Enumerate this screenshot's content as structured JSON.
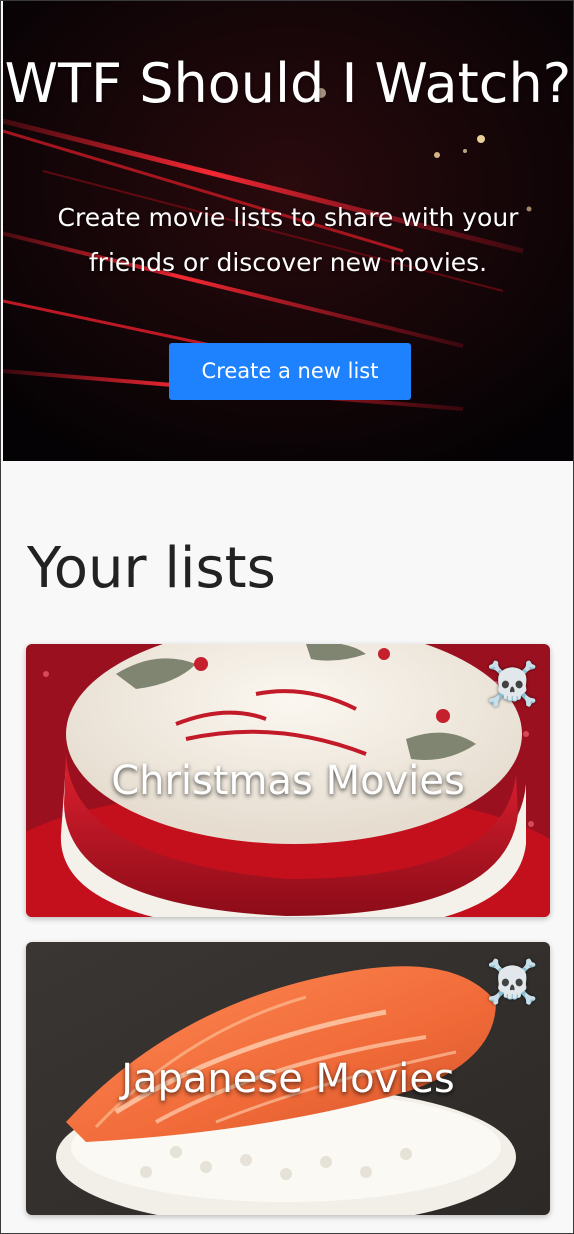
{
  "hero": {
    "title": "WTF Should I Watch?",
    "subtitle": "Create movie lists to share with your friends or discover new movies.",
    "button_label": "Create a new list"
  },
  "lists_section": {
    "title": "Your lists",
    "items": [
      {
        "title": "Christmas Movies",
        "delete_icon": "☠️",
        "icon_name": "skull-and-crossbones-icon"
      },
      {
        "title": "Japanese Movies",
        "delete_icon": "☠️",
        "icon_name": "skull-and-crossbones-icon"
      }
    ]
  },
  "colors": {
    "accent": "#1e82ff",
    "hero_background": "#050305",
    "page_background": "#f8f8f8",
    "title_text": "#222222"
  }
}
